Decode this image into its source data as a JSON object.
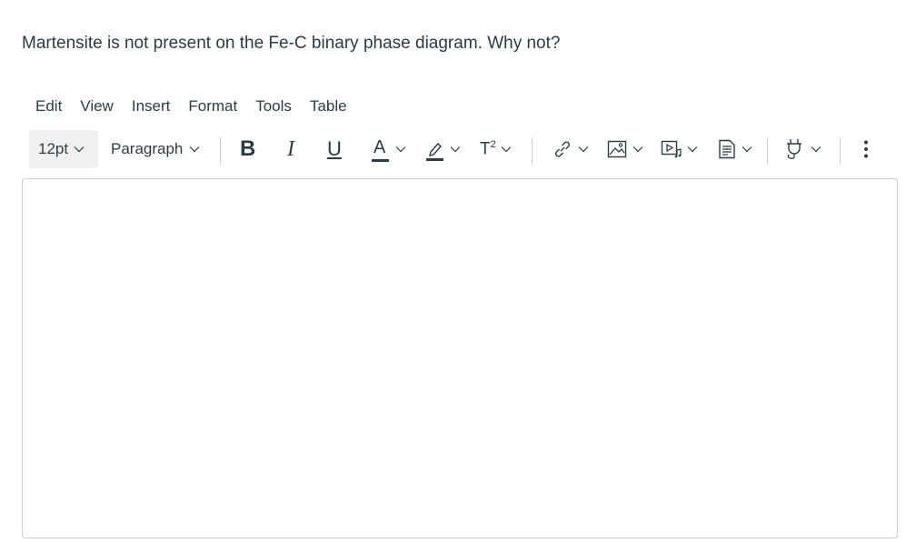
{
  "question": {
    "text": "Martensite is not present on the Fe-C binary phase diagram. Why not?"
  },
  "menubar": {
    "items": [
      "Edit",
      "View",
      "Insert",
      "Format",
      "Tools",
      "Table"
    ]
  },
  "toolbar": {
    "font_size": "12pt",
    "block_format": "Paragraph",
    "icons": [
      "bold-icon",
      "italic-icon",
      "underline-icon",
      "text-color-icon",
      "highlight-icon",
      "superscript-icon",
      "link-icon",
      "image-icon",
      "media-icon",
      "document-icon",
      "plugin-icon",
      "more-options-icon"
    ],
    "bold_label": "B",
    "italic_label": "I",
    "underline_label": "U",
    "text_color_label": "A",
    "superscript_label": "T",
    "superscript_sup": "2"
  },
  "colors": {
    "text": "#2d3b45",
    "border": "#c7cdd1",
    "fontsize_bg": "#f0f0f0"
  },
  "editor": {
    "content": ""
  }
}
